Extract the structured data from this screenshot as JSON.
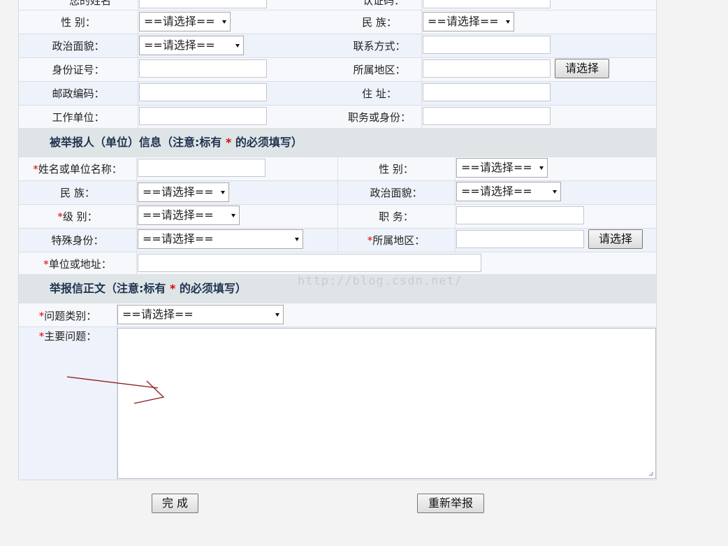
{
  "reporter_section": {
    "partial_top_left": "您的姓名",
    "partial_top_right": "认证码：",
    "rows": [
      {
        "left_label": "性 别：",
        "left_select": "==请选择==",
        "right_label": "民 族：",
        "right_select": "==请选择=="
      },
      {
        "left_label": "政治面貌：",
        "left_select": "==请选择==",
        "right_label": "联系方式："
      },
      {
        "left_label": "身份证号：",
        "right_label": "所属地区：",
        "right_button": "请选择"
      },
      {
        "left_label": "邮政编码：",
        "right_label": "住 址："
      },
      {
        "left_label": "工作单位：",
        "right_label": "职务或身份："
      }
    ]
  },
  "reported_section": {
    "heading_prefix": "被举报人（单位）信息（注意:标有 ",
    "heading_star": "*",
    "heading_suffix": " 的必须填写）",
    "name_label": "姓名或单位名称：",
    "gender_label": "性 别：",
    "gender_select": "==请选择==",
    "ethnicity_label": "民 族：",
    "ethnicity_select": "==请选择==",
    "political_label": "政治面貌：",
    "political_select": "==请选择==",
    "level_label": "级 别：",
    "level_select": "==请选择==",
    "position_label": "职 务：",
    "identity_label": "特殊身份：",
    "identity_select": "==请选择==",
    "region_label": "所属地区：",
    "region_button": "请选择",
    "address_label": "单位或地址：",
    "star": "*"
  },
  "report_section": {
    "heading_prefix": "举报信正文（注意:标有 ",
    "heading_star": "*",
    "heading_suffix": " 的必须填写）",
    "category_label": "问题类别：",
    "category_select": "==请选择==",
    "main_issue_label": "主要问题：",
    "star": "*"
  },
  "watermark": "http://blog.csdn.net/",
  "actions": {
    "submit": "完 成",
    "reset": "重新举报"
  },
  "colors": {
    "required_star": "#dd0000",
    "section_band": "#dfe5e7",
    "annotation_arrow": "#8b1a1a"
  }
}
